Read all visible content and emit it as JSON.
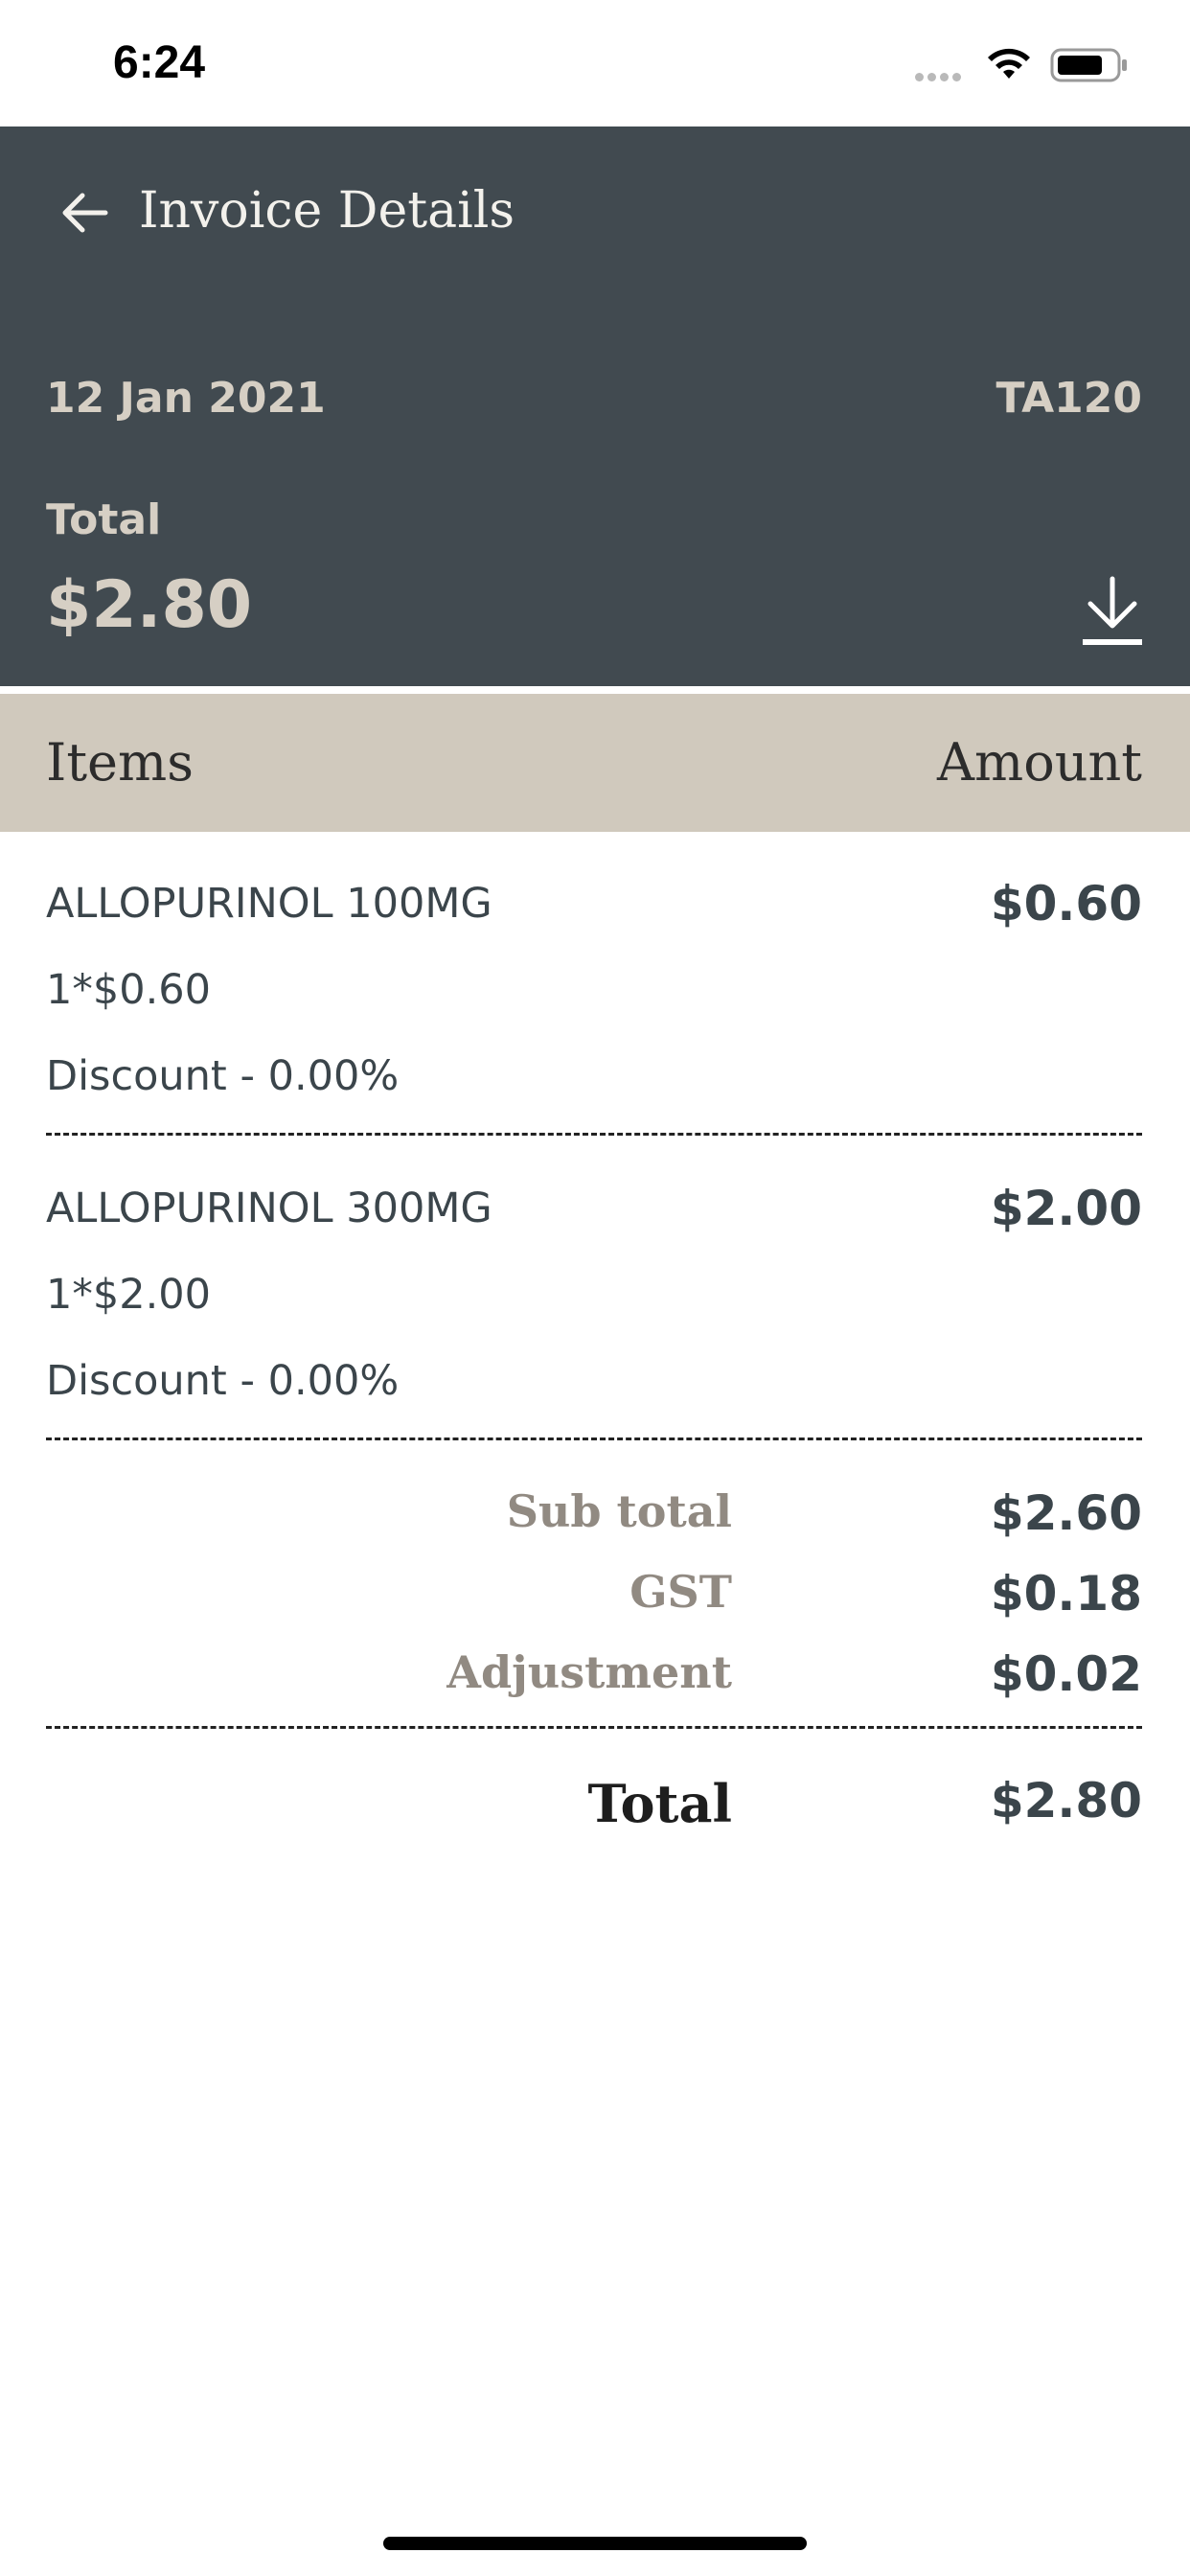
{
  "status_bar": {
    "time": "6:24"
  },
  "header": {
    "title": "Invoice Details",
    "date": "12 Jan 2021",
    "invoice_id": "TA120",
    "total_label": "Total",
    "total_value": "$2.80"
  },
  "columns": {
    "items": "Items",
    "amount": "Amount"
  },
  "items": [
    {
      "name": "ALLOPURINOL 100MG",
      "qty": "1*$0.60",
      "discount": "Discount - 0.00%",
      "amount": "$0.60"
    },
    {
      "name": "ALLOPURINOL 300MG",
      "qty": "1*$2.00",
      "discount": "Discount - 0.00%",
      "amount": "$2.00"
    }
  ],
  "summary": {
    "subtotal_label": "Sub total",
    "subtotal_value": "$2.60",
    "gst_label": "GST",
    "gst_value": "$0.18",
    "adjustment_label": "Adjustment",
    "adjustment_value": "$0.02",
    "total_label": "Total",
    "total_value": "$2.80"
  },
  "icons": {
    "back": "arrow-left-icon",
    "download": "download-icon",
    "wifi": "wifi-icon",
    "battery": "battery-icon"
  },
  "colors": {
    "header_bg": "#414a50",
    "column_header_bg": "#d0c9bd",
    "header_text": "#d6cfc4",
    "body_text": "#3b454b",
    "muted_label": "#918a82"
  }
}
